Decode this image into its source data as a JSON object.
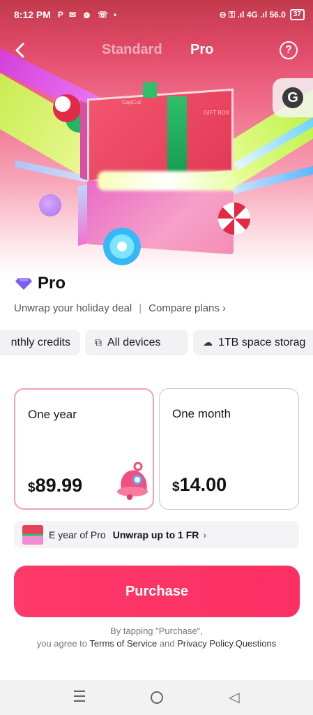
{
  "status": {
    "time": "8:12 PM",
    "left_icons": [
      "P",
      "✉",
      "⏰",
      "☏",
      "•"
    ],
    "right_text": "⊖ ⚿ .ıl 4G .ıl 56.0",
    "battery": "37"
  },
  "nav": {
    "tabs": [
      {
        "label": "Standard",
        "active": false
      },
      {
        "label": "Pro",
        "active": true
      }
    ],
    "help": "?"
  },
  "hero": {
    "lid_brand": "CapCut",
    "lid_label": "GIFT BOX"
  },
  "plan_title": "Pro",
  "tagline": "Unwrap your holiday deal",
  "separator": "|",
  "compare_link": "Compare plans ›",
  "features": [
    {
      "icon": "",
      "label": "nthly credits"
    },
    {
      "icon": "⧉",
      "label": "All devices"
    },
    {
      "icon": "☁",
      "label": "1TB space storag"
    }
  ],
  "plans": [
    {
      "name": "One year",
      "currency": "$",
      "price": "89.99",
      "selected": true
    },
    {
      "name": "One month",
      "currency": "$",
      "price": "14.00",
      "selected": false
    }
  ],
  "promo": {
    "text": "E year of Pro",
    "highlight": "Unwrap up to 1 FR",
    "chevron": "›"
  },
  "purchase_label": "Purchase",
  "legal": {
    "line1": "By tapping \"Purchase\",",
    "prefix": "you agree to ",
    "terms": "Terms of Service",
    "and": " and ",
    "privacy": "Privacy Policy",
    "dot": ".",
    "questions": "Questions"
  },
  "system_nav": {
    "menu": "☰",
    "back": "◁"
  },
  "colors": {
    "accent": "#fb2f63",
    "selected_border": "#f2a0bb",
    "diamond": "#7b5cf5"
  }
}
